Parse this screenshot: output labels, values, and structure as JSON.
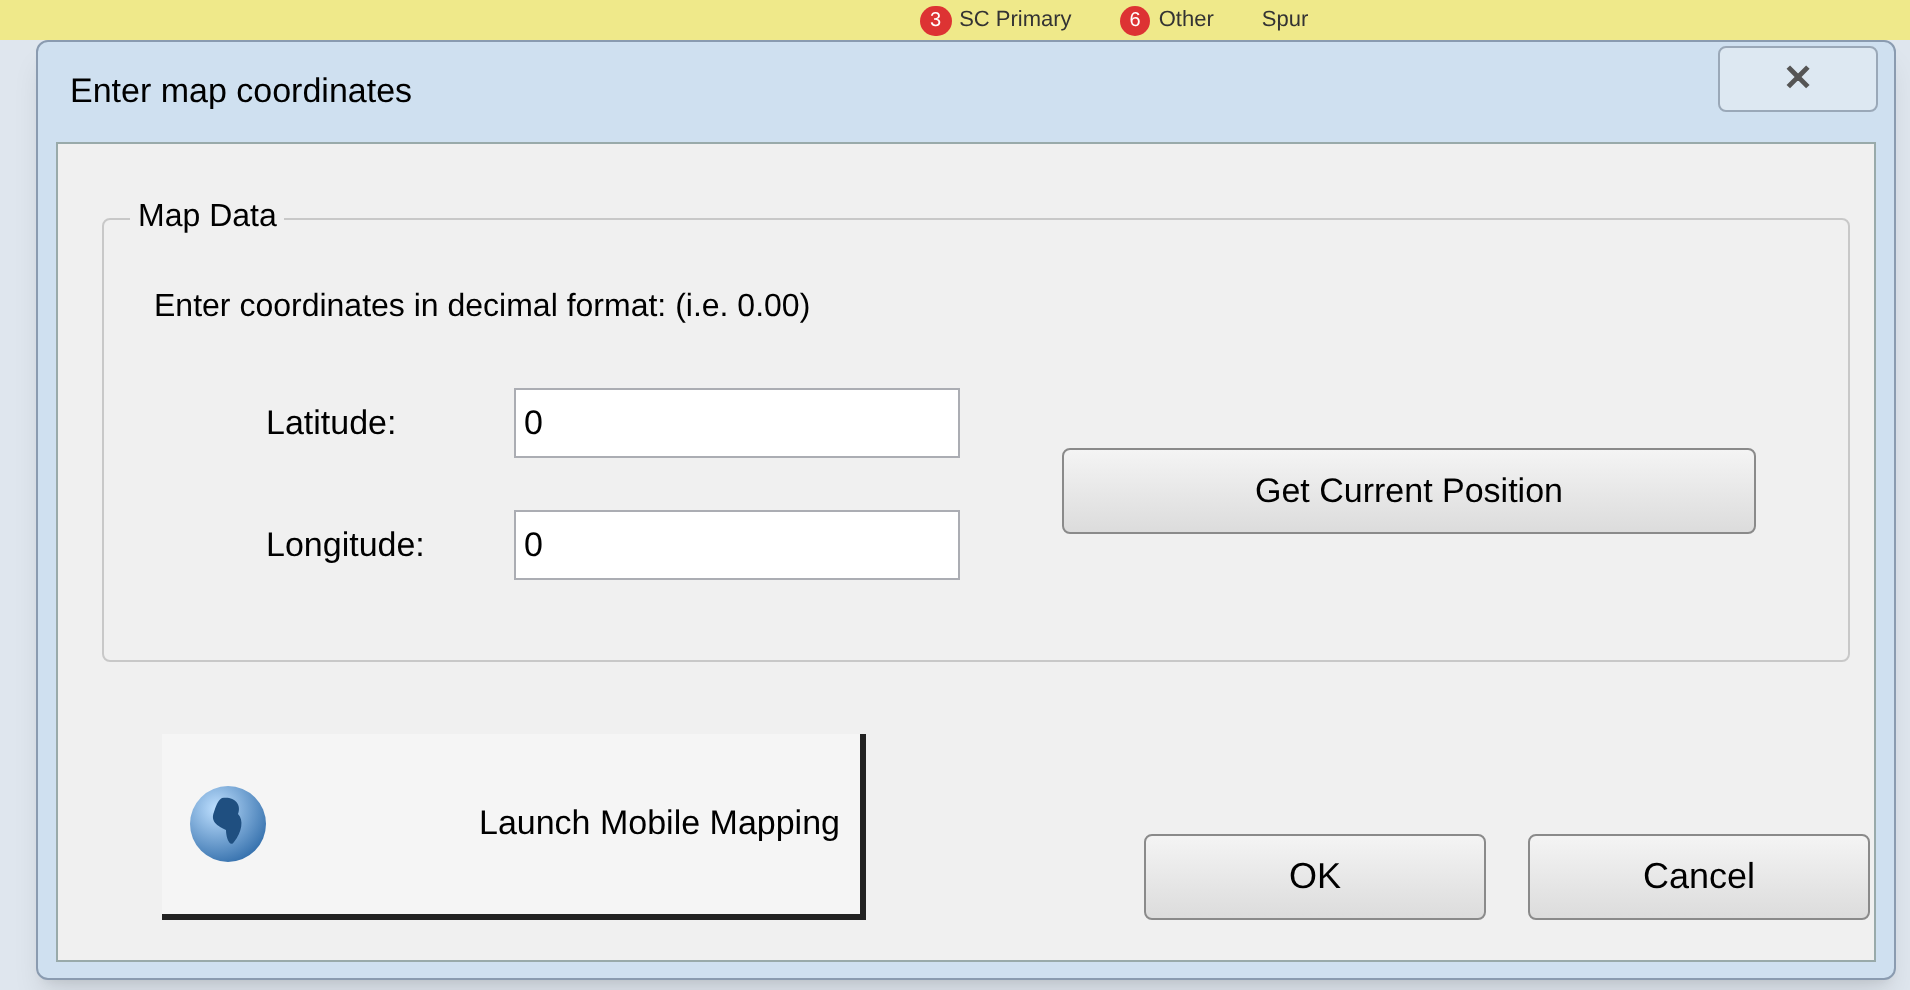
{
  "background": {
    "labels": [
      {
        "text": "SC Primary",
        "badge": "3"
      },
      {
        "text": "Other",
        "badge": "6"
      },
      {
        "text": "Spur"
      }
    ]
  },
  "window": {
    "title": "Enter map coordinates",
    "close": "✕"
  },
  "group": {
    "legend": "Map Data",
    "instruction": "Enter coordinates in decimal format: (i.e. 0.00)",
    "fields": [
      {
        "label": "Latitude:",
        "value": "0"
      },
      {
        "label": "Longitude:",
        "value": "0"
      }
    ],
    "position_button": "Get Current Position"
  },
  "launch_button": "Launch Mobile Mapping",
  "buttons": [
    "OK",
    "Cancel"
  ]
}
